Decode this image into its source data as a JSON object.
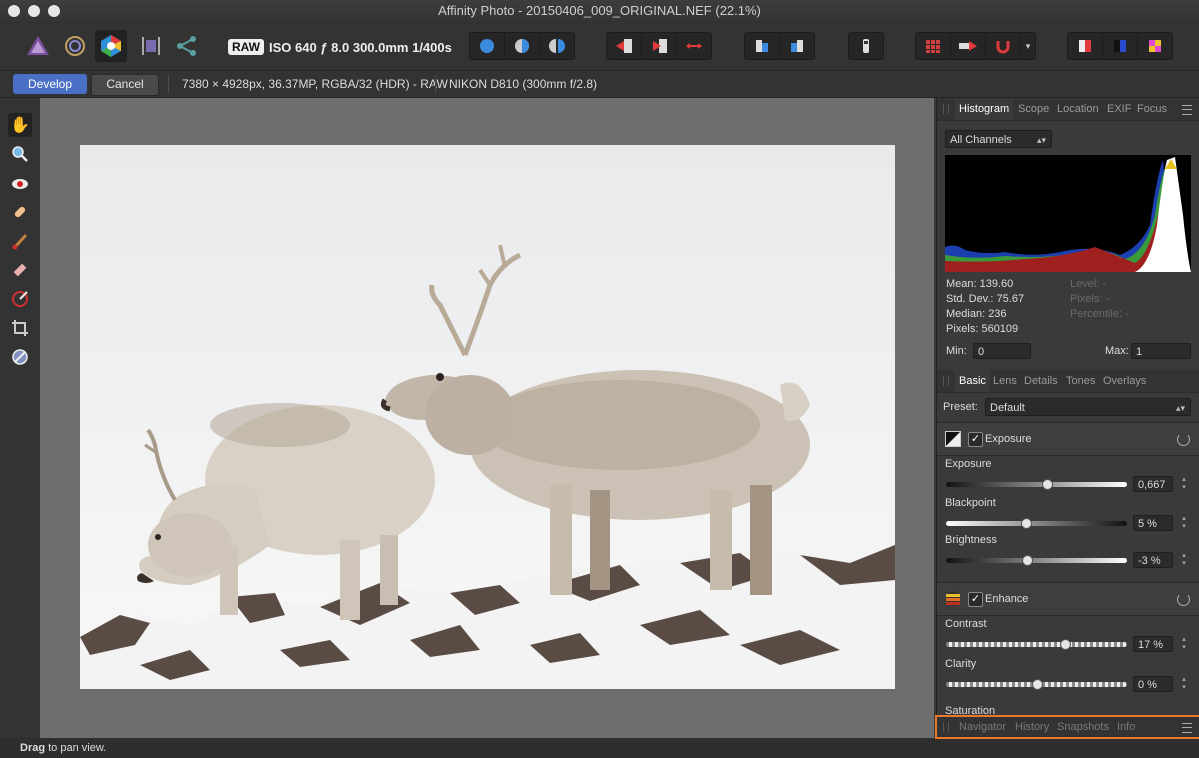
{
  "window": {
    "title": "Affinity Photo - 20150406_009_ORIGINAL.NEF (22.1%)"
  },
  "toolbar": {
    "raw_badge": "RAW",
    "raw_info": "ISO 640 ƒ 8.0 300.0mm 1/400s",
    "personas": [
      "photo-persona-icon",
      "liquify-persona-icon",
      "develop-persona-icon",
      "tone-mapping-persona-icon",
      "export-persona-icon"
    ]
  },
  "context": {
    "develop_label": "Develop",
    "cancel_label": "Cancel",
    "image_info": "7380 × 4928px, 36.37MP, RGBA/32 (HDR) - RAW",
    "camera_info": "NIKON D810 (300mm f/2.8)"
  },
  "tools": [
    "hand-tool-icon",
    "zoom-tool-icon",
    "red-eye-tool-icon",
    "blemish-removal-tool-icon",
    "overlay-paint-tool-icon",
    "overlay-erase-tool-icon",
    "overlay-gradient-tool-icon",
    "crop-tool-icon",
    "white-balance-tool-icon"
  ],
  "status": {
    "bold": "Drag",
    "text": " to pan view."
  },
  "histogram_panel": {
    "tabs": [
      "Histogram",
      "Scope",
      "Location",
      "EXIF",
      "Focus"
    ],
    "channel": "All Channels",
    "mean": "Mean: 139.60",
    "stddev": "Std. Dev.: 75.67",
    "median": "Median: 236",
    "pixels": "Pixels: 560109",
    "level": "Level: -",
    "pixels_r": "Pixels: -",
    "percentile": "Percentile: -",
    "min_label": "Min:",
    "min_value": "0",
    "max_label": "Max:",
    "max_value": "1"
  },
  "develop_panel": {
    "tabs": [
      "Basic",
      "Lens",
      "Details",
      "Tones",
      "Overlays"
    ],
    "preset_label": "Preset:",
    "preset_value": "Default",
    "exposure_section": "Exposure",
    "enhance_section": "Enhance",
    "sliders": [
      {
        "label": "Exposure",
        "value": "0,667",
        "fraction": 0.56
      },
      {
        "label": "Blackpoint",
        "value": "5 %",
        "fraction": 0.44
      },
      {
        "label": "Brightness",
        "value": "-3 %",
        "fraction": 0.45
      },
      {
        "label": "Contrast",
        "value": "17 %",
        "fraction": 0.66
      },
      {
        "label": "Clarity",
        "value": "0 %",
        "fraction": 0.5
      }
    ],
    "saturation_label": "Saturation"
  },
  "bottom_panel": {
    "tabs": [
      "Navigator",
      "History",
      "Snapshots",
      "Info"
    ]
  },
  "colors": {
    "accent": "#4a70c5",
    "highlight": "#e8792a"
  }
}
